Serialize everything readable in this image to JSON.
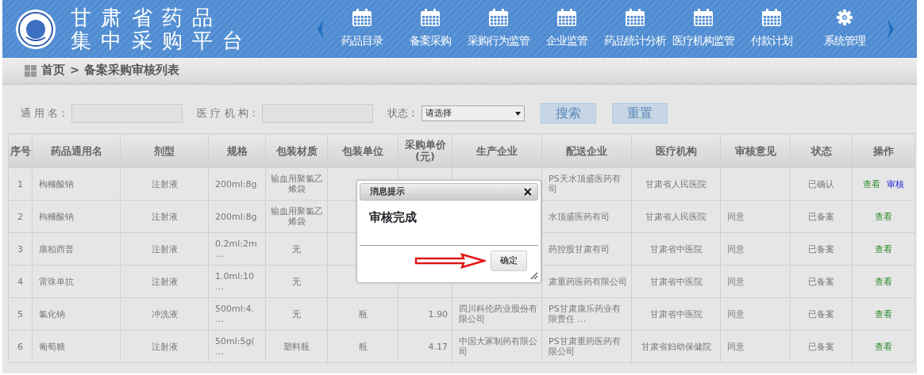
{
  "header": {
    "title_lines": [
      "甘 肃 省 药 品",
      "集 中 采 购 平 台"
    ],
    "nav": [
      {
        "label": "药品目录",
        "kind": "module"
      },
      {
        "label": "备案采购",
        "kind": "module"
      },
      {
        "label": "采购行为监管",
        "kind": "module"
      },
      {
        "label": "企业监管",
        "kind": "module"
      },
      {
        "label": "药品统计分析",
        "kind": "module"
      },
      {
        "label": "医疗机构监管",
        "kind": "module"
      },
      {
        "label": "付款计划",
        "kind": "module"
      },
      {
        "label": "系统管理",
        "kind": "settings"
      }
    ]
  },
  "breadcrumb": {
    "home": "首页",
    "separator": ">",
    "current": "备案采购审核列表"
  },
  "filters": {
    "generic_name_label": "通 用 名：",
    "institution_label": "医 疗 机 构：",
    "status_label": "状态：",
    "status_value": "请选择",
    "search_button": "搜索",
    "reset_button": "重置"
  },
  "table": {
    "columns": [
      "序号",
      "药品通用名",
      "剂型",
      "规格",
      "包装材质",
      "包装单位",
      "采购单价\n(元)",
      "生产企业",
      "配送企业",
      "医疗机构",
      "审核意见",
      "状态",
      "操作"
    ],
    "rows": [
      {
        "cells": [
          "1",
          "枸橼酸钠",
          "注射液",
          "200ml:8g",
          "输血用聚氯乙烯袋",
          null,
          null,
          null,
          "PS天水顶盛医药有司",
          "甘肃省人民医院",
          null,
          "已确认"
        ],
        "actions": [
          {
            "label": "查看",
            "kind": "view"
          },
          {
            "label": "审核",
            "kind": "audit"
          }
        ]
      },
      {
        "cells": [
          "2",
          "枸橼酸钠",
          "注射液",
          "200ml:8g",
          "输血用聚氯乙烯袋",
          null,
          null,
          null,
          "水顶盛医药有司",
          "甘肃省人民医院",
          "同意",
          "已备案"
        ],
        "actions": [
          {
            "label": "查看",
            "kind": "view"
          }
        ]
      },
      {
        "cells": [
          "3",
          "康柏西普",
          "注射液",
          "0.2ml:2m\n…",
          "无",
          null,
          null,
          null,
          "药控股甘肃有司",
          "甘肃省中医院",
          "同意",
          "已备案"
        ],
        "actions": [
          {
            "label": "查看",
            "kind": "view"
          }
        ]
      },
      {
        "cells": [
          "4",
          "雷珠单抗",
          "注射液",
          "1.0ml:10\n…",
          "无",
          null,
          null,
          null,
          "肃重药医药有限公司",
          "甘肃省中医院",
          "同意",
          "已备案"
        ],
        "actions": [
          {
            "label": "查看",
            "kind": "view"
          }
        ]
      },
      {
        "cells": [
          "5",
          "氯化钠",
          "冲洗液",
          "500ml:4.\n…",
          "无",
          "瓶",
          "1.90",
          "四川科伦药业股份有限公司",
          "PS甘肃康乐药业有限责任 …",
          "甘肃省中医院",
          "同意",
          "已备案"
        ],
        "actions": [
          {
            "label": "查看",
            "kind": "view"
          }
        ]
      },
      {
        "cells": [
          "6",
          "葡萄糖",
          "注射液",
          "50ml:5g(\n…",
          "塑料瓶",
          "瓶",
          "4.17",
          "中国大冢制药有限公司",
          "PS甘肃重药医药有限公司",
          "甘肃省妇幼保健院",
          "同意",
          "已备案"
        ],
        "actions": [
          {
            "label": "查看",
            "kind": "view"
          }
        ]
      }
    ]
  },
  "dialog": {
    "title": "消息提示",
    "message": "审核完成",
    "ok_button": "确定",
    "close": "×"
  }
}
